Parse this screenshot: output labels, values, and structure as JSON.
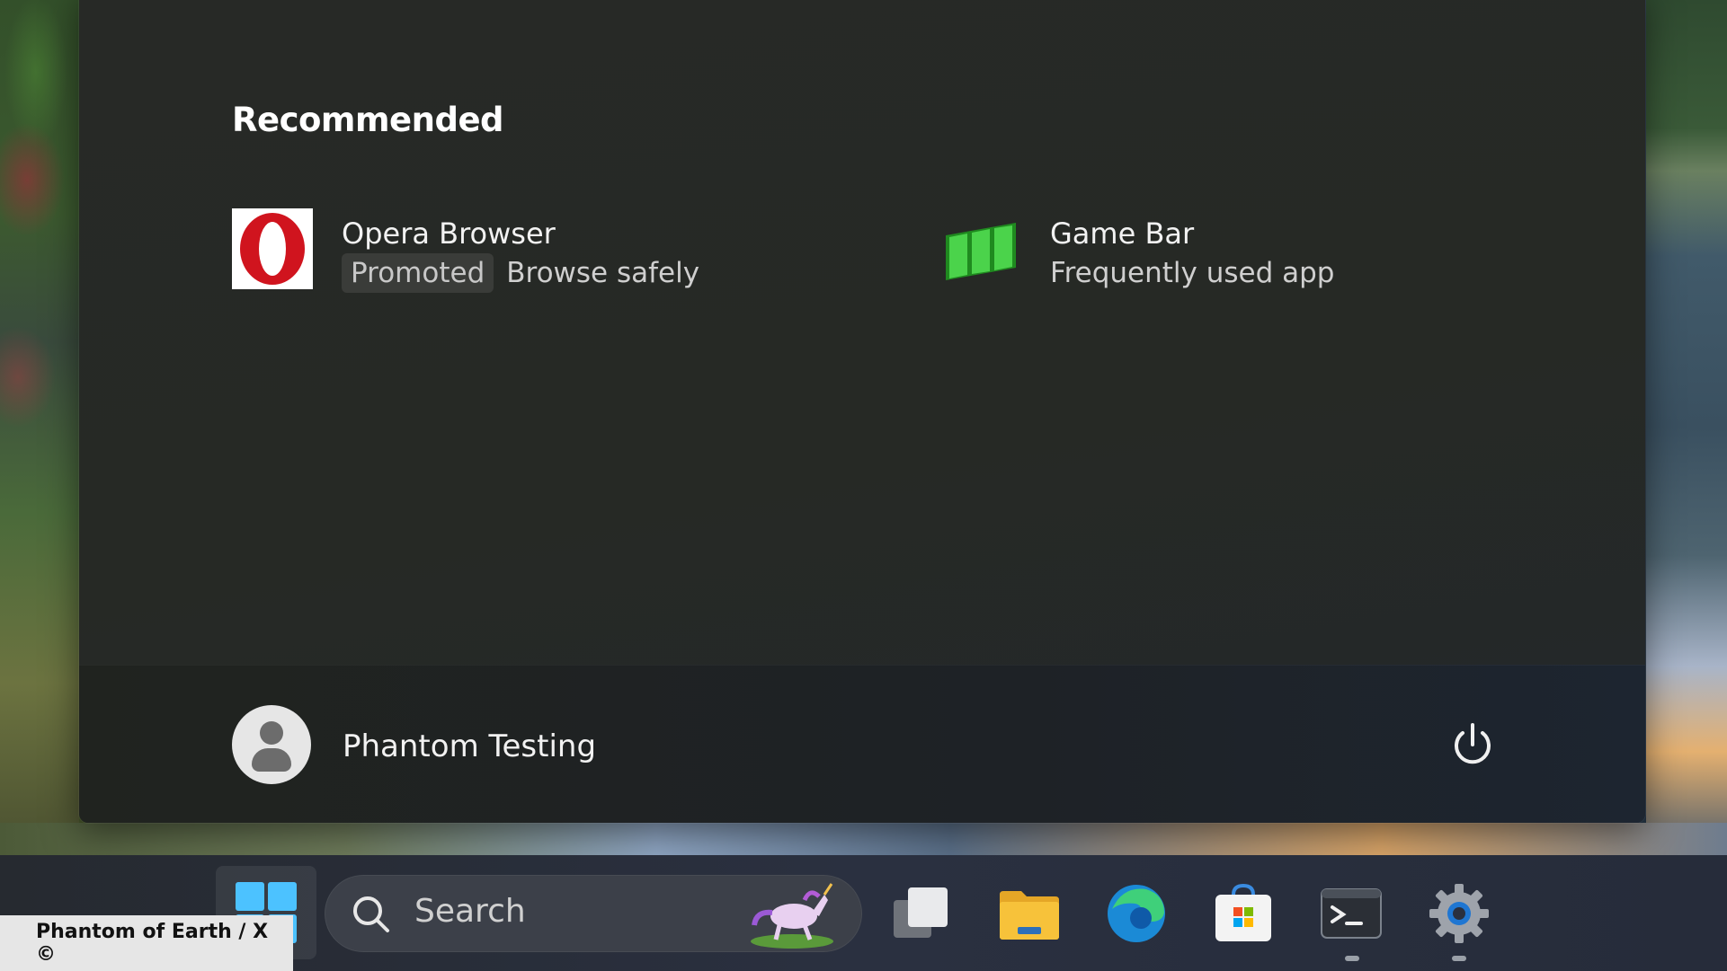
{
  "start_menu": {
    "recommended_title": "Recommended",
    "items": [
      {
        "name": "Opera Browser",
        "badge": "Promoted",
        "subtitle": "Browse safely",
        "icon": "opera-icon"
      },
      {
        "name": "Game Bar",
        "subtitle": "Frequently used app",
        "icon": "game-bar-icon"
      }
    ],
    "user": {
      "name": "Phantom Testing",
      "icon": "avatar-icon"
    },
    "power_icon": "power-icon"
  },
  "taskbar": {
    "search_placeholder": "Search",
    "icons": [
      "windows-start-icon",
      "search-icon",
      "unicorn-highlight-icon",
      "task-view-icon",
      "file-explorer-icon",
      "edge-icon",
      "microsoft-store-icon",
      "terminal-icon",
      "settings-icon"
    ]
  },
  "watermark": "Phantom of Earth / X ©",
  "colors": {
    "menu_bg": "#262925",
    "accent_start": "#4cc2ff",
    "opera_red": "#d0141e",
    "game_bar_green": "#2bb52b",
    "explorer_yellow": "#f7c23a"
  }
}
